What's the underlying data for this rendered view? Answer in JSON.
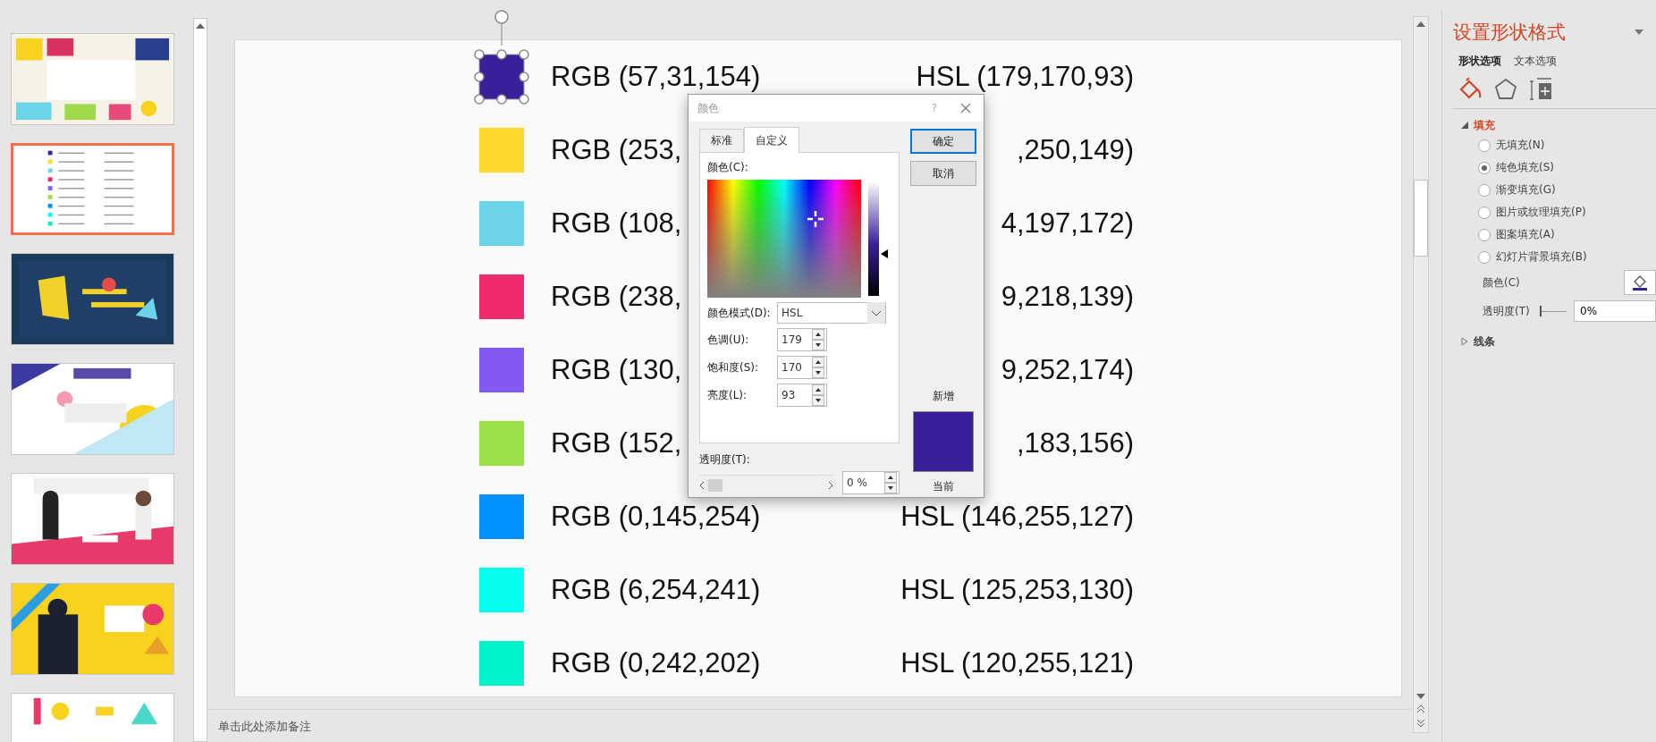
{
  "thumbnails": [
    {
      "kind": "picture",
      "selected": false
    },
    {
      "kind": "picture",
      "selected": true
    },
    {
      "kind": "picture",
      "selected": false
    },
    {
      "kind": "picture",
      "selected": false
    },
    {
      "kind": "picture",
      "selected": false
    },
    {
      "kind": "picture",
      "selected": false
    },
    {
      "kind": "picture",
      "selected": false
    }
  ],
  "slide": {
    "rows": [
      {
        "color": "#391f9a",
        "rgb": "RGB (57,31,154)",
        "hsl": "HSL (179,170,93)",
        "selected": true
      },
      {
        "color": "#fdd92a",
        "rgb": "RGB (253,",
        "hsl": ",250,149)",
        "selected": false
      },
      {
        "color": "#6cd4e8",
        "rgb": "RGB (108,",
        "hsl": "4,197,172)",
        "selected": false
      },
      {
        "color": "#ee2a6a",
        "rgb": "RGB (238,",
        "hsl": "9,218,139)",
        "selected": false
      },
      {
        "color": "#8259f5",
        "rgb": "RGB (130,",
        "hsl": "9,252,174)",
        "selected": false
      },
      {
        "color": "#98e04a",
        "rgb": "RGB (152,",
        "hsl": ",183,156)",
        "selected": false
      },
      {
        "color": "#0091fe",
        "rgb": "RGB (0,145,254)",
        "hsl": "HSL (146,255,127)",
        "selected": false
      },
      {
        "color": "#06fef1",
        "rgb": "RGB (6,254,241)",
        "hsl": "HSL (125,253,130)",
        "selected": false
      },
      {
        "color": "#00f2ca",
        "rgb": "RGB (0,242,202)",
        "hsl": "HSL (120,255,121)",
        "selected": false
      }
    ]
  },
  "color_dialog": {
    "title": "颜色",
    "help": "?",
    "tabs": [
      {
        "label": "标准",
        "selected": false
      },
      {
        "label": "自定义",
        "selected": true
      }
    ],
    "color_label": "颜色(C):",
    "mode_label": "颜色模式(D):",
    "mode": "HSL",
    "fields": [
      {
        "label": "色调(U):",
        "value": "179"
      },
      {
        "label": "饱和度(S):",
        "value": "170"
      },
      {
        "label": "亮度(L):",
        "value": "93"
      }
    ],
    "transparency_label": "透明度(T):",
    "transparency_slider": {
      "level": 0
    },
    "transparency": "0 %",
    "buttons": [
      {
        "label": "确定",
        "default": true
      },
      {
        "label": "取消",
        "default": false
      }
    ],
    "new_label": "新增",
    "current_label": "当前"
  },
  "notes": {
    "placeholder": "单击此处添加备注"
  },
  "format_panel": {
    "title": "设置形状格式",
    "tabs": [
      {
        "label": "形状选项",
        "selected": true
      },
      {
        "label": "文本选项",
        "selected": false
      }
    ],
    "icon_tabs": [
      {
        "kind": "fill",
        "selected": true
      },
      {
        "kind": "effects",
        "selected": false
      },
      {
        "kind": "size",
        "selected": false
      }
    ],
    "fill_section": {
      "title": "填充",
      "expanded": true,
      "options": [
        {
          "label": "无填充(N)",
          "selected": false
        },
        {
          "label": "纯色填充(S)",
          "selected": true
        },
        {
          "label": "渐变填充(G)",
          "selected": false
        },
        {
          "label": "图片或纹理填充(P)",
          "selected": false
        },
        {
          "label": "图案填充(A)",
          "selected": false
        },
        {
          "label": "幻灯片背景填充(B)",
          "selected": false
        }
      ],
      "color_label": "颜色(C)",
      "transparency_label": "透明度(T)",
      "transparency_slider": {
        "level": 0
      },
      "transparency": "0%"
    },
    "line_section": {
      "title": "线条",
      "expanded": false
    }
  }
}
